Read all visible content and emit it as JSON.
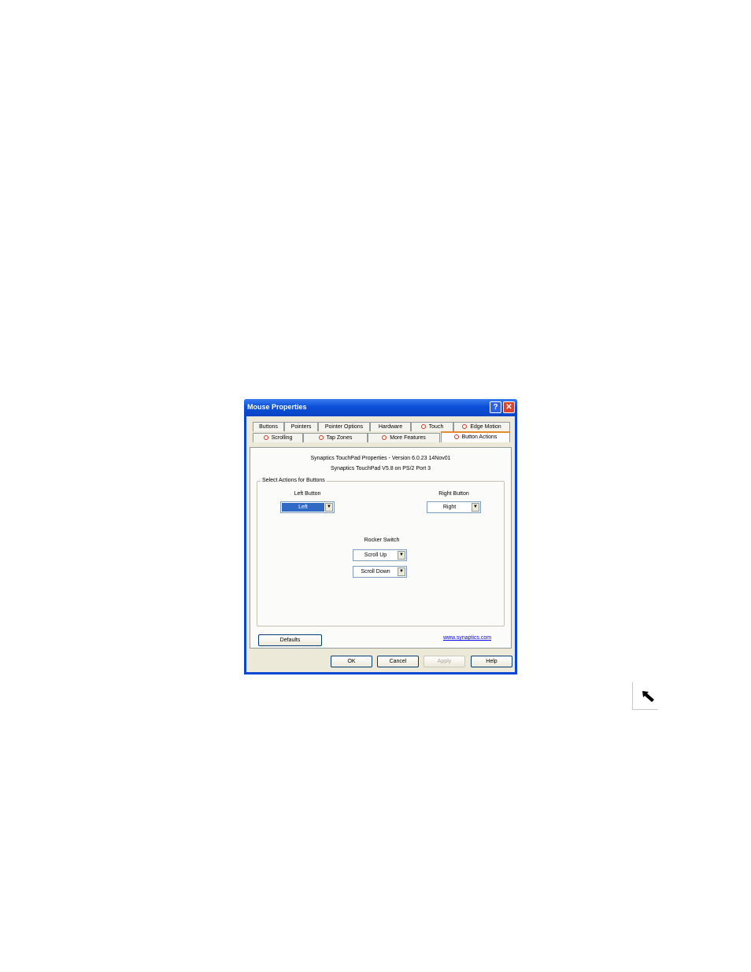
{
  "window": {
    "title": "Mouse Properties",
    "help_glyph": "?",
    "close_glyph": "✕"
  },
  "tabs_row1": [
    "Buttons",
    "Pointers",
    "Pointer Options",
    "Hardware",
    "Touch",
    "Edge Motion"
  ],
  "tabs_row2": [
    "Scrolling",
    "Tap Zones",
    "More Features",
    "Button Actions"
  ],
  "active_tab": "Button Actions",
  "info": {
    "line1": "Synaptics TouchPad Properties - Version 6.0.23 14Nov01",
    "line2": "Synaptics TouchPad V5.8 on PS/2 Port 3"
  },
  "group": {
    "label": "Select Actions for Buttons",
    "left_button_label": "Left Button",
    "left_button_value": "Left",
    "right_button_label": "Right Button",
    "right_button_value": "Right",
    "rocker_label": "Rocker Switch",
    "rocker_up_value": "Scroll Up",
    "rocker_down_value": "Scroll Down"
  },
  "defaults_button": "Defaults",
  "link": "www.synaptics.com",
  "dialog_buttons": {
    "ok": "OK",
    "cancel": "Cancel",
    "apply": "Apply",
    "help": "Help"
  },
  "icons": {
    "tab_icon": "synaptics-touchpad-icon",
    "dropdown": "dropdown-arrow-icon",
    "cursor": "cursor-arrow-icon"
  },
  "colors": {
    "title_bar": "#0a46d4",
    "selection": "#316ac5",
    "active_tab_accent": "#e68b2c"
  }
}
